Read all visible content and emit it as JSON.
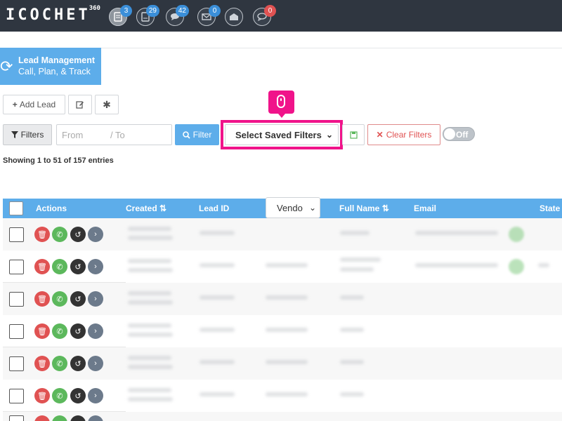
{
  "app": {
    "logo_text": "ICOCHET",
    "logo_sup": "360"
  },
  "nav_icons": [
    {
      "icon": "document-icon",
      "badge": "3",
      "badge_color": "#3b8fd9"
    },
    {
      "icon": "report-icon",
      "badge": "29",
      "badge_color": "#3b8fd9"
    },
    {
      "icon": "chat-icon",
      "badge": "42",
      "badge_color": "#3b8fd9"
    },
    {
      "icon": "mail-icon",
      "badge": "0",
      "badge_color": "#3b8fd9"
    },
    {
      "icon": "open-mail-icon",
      "badge": "",
      "badge_color": ""
    },
    {
      "icon": "comment-icon",
      "badge": "0",
      "badge_color": "#e05252"
    }
  ],
  "tab": {
    "title": "Lead Management",
    "subtitle": "Call, Plan, & Track"
  },
  "toolbar": {
    "add_lead": "Add Lead"
  },
  "filters": {
    "filters_label": "Filters",
    "from_placeholder": "From",
    "to_placeholder": "/ To",
    "filter_button": "Filter",
    "saved_filters": "Select Saved Filters",
    "clear_filters": "Clear Filters",
    "toggle_label": "Off"
  },
  "showing_text": "Showing 1 to 51 of 157 entries",
  "table": {
    "headers": {
      "actions": "Actions",
      "created": "Created",
      "lead_id": "Lead ID",
      "vendor": "Vendo",
      "full_name": "Full Name",
      "email": "Email",
      "state": "State"
    }
  },
  "colors": {
    "accent": "#5dadea",
    "highlight": "#f0138a",
    "topbar": "#2f3640"
  }
}
